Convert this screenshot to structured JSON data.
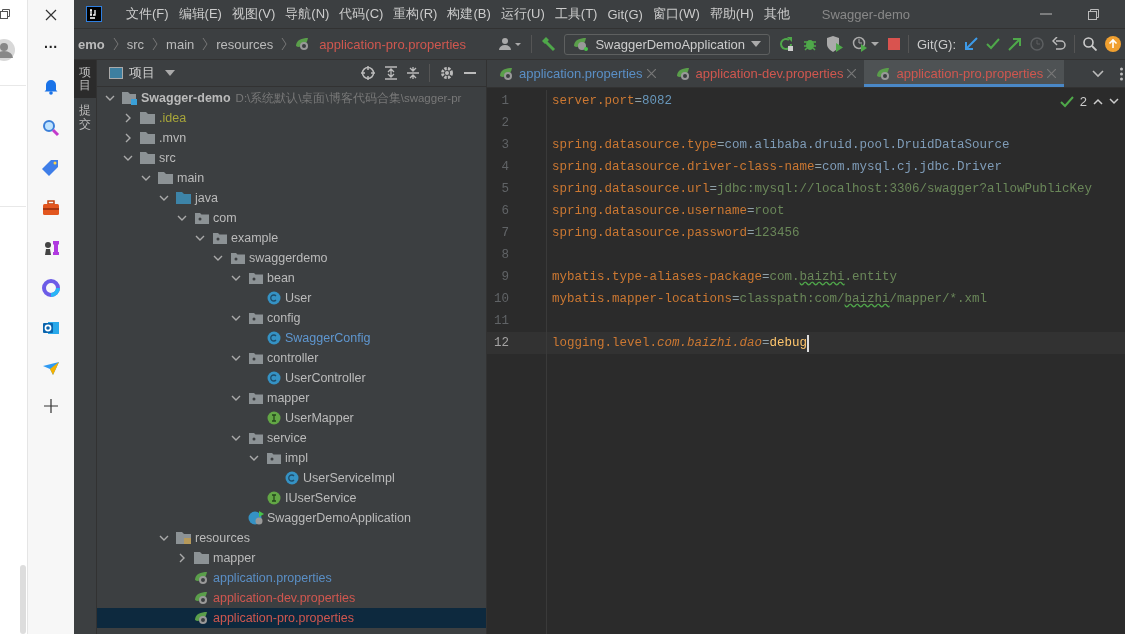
{
  "browser_sidebar": {
    "more": "···"
  },
  "menu": [
    "文件(F)",
    "编辑(E)",
    "视图(V)",
    "导航(N)",
    "代码(C)",
    "重构(R)",
    "构建(B)",
    "运行(U)",
    "工具(T)",
    "Git(G)",
    "窗口(W)",
    "帮助(H)",
    "其他"
  ],
  "window": {
    "title": "Swagger-demo"
  },
  "breadcrumbs": [
    {
      "label": "emo",
      "kind": "folder"
    },
    {
      "label": "src",
      "kind": "folder"
    },
    {
      "label": "main",
      "kind": "folder"
    },
    {
      "label": "resources",
      "kind": "folder"
    },
    {
      "label": "application-pro.properties",
      "kind": "file"
    }
  ],
  "run_config": {
    "label": "SwaggerDemoApplication"
  },
  "git_label": "Git(G):",
  "tool_strip": [
    {
      "label": "项目",
      "selected": true
    },
    {
      "label": "提交",
      "selected": false
    }
  ],
  "project_panel": {
    "title": "项目"
  },
  "tree": [
    {
      "label": "Swagger-demo",
      "path": "D:\\系统默认\\桌面\\博客代码合集\\swagger-pr",
      "kind": "module",
      "expanded": true,
      "selected": false,
      "color": "#bbbbbb",
      "children": [
        {
          "label": ".idea",
          "kind": "folder",
          "expanded": false,
          "selected": false,
          "color": "#a8a63a"
        },
        {
          "label": ".mvn",
          "kind": "folder",
          "expanded": false,
          "selected": false,
          "color": "#bbbbbb"
        },
        {
          "label": "src",
          "kind": "folder",
          "expanded": true,
          "selected": false,
          "color": "#bbbbbb",
          "children": [
            {
              "label": "main",
              "kind": "folder",
              "expanded": true,
              "selected": false,
              "color": "#bbbbbb",
              "children": [
                {
                  "label": "java",
                  "kind": "source",
                  "expanded": true,
                  "selected": false,
                  "color": "#bbbbbb",
                  "children": [
                    {
                      "label": "com",
                      "kind": "package",
                      "expanded": true,
                      "selected": false,
                      "color": "#bbbbbb",
                      "children": [
                        {
                          "label": "example",
                          "kind": "package",
                          "expanded": true,
                          "selected": false,
                          "color": "#bbbbbb",
                          "children": [
                            {
                              "label": "swaggerdemo",
                              "kind": "package",
                              "expanded": true,
                              "selected": false,
                              "color": "#bbbbbb",
                              "children": [
                                {
                                  "label": "bean",
                                  "kind": "package",
                                  "expanded": true,
                                  "selected": false,
                                  "color": "#bbbbbb",
                                  "children": [
                                    {
                                      "label": "User",
                                      "kind": "class",
                                      "selected": false,
                                      "color": "#bbbbbb"
                                    }
                                  ]
                                },
                                {
                                  "label": "config",
                                  "kind": "package",
                                  "expanded": true,
                                  "selected": false,
                                  "color": "#bbbbbb",
                                  "children": [
                                    {
                                      "label": "SwaggerConfig",
                                      "kind": "class",
                                      "selected": false,
                                      "color": "#5f97d0"
                                    }
                                  ]
                                },
                                {
                                  "label": "controller",
                                  "kind": "package",
                                  "expanded": true,
                                  "selected": false,
                                  "color": "#bbbbbb",
                                  "children": [
                                    {
                                      "label": "UserController",
                                      "kind": "class",
                                      "selected": false,
                                      "color": "#bbbbbb"
                                    }
                                  ]
                                },
                                {
                                  "label": "mapper",
                                  "kind": "package",
                                  "expanded": true,
                                  "selected": false,
                                  "color": "#bbbbbb",
                                  "children": [
                                    {
                                      "label": "UserMapper",
                                      "kind": "interface",
                                      "selected": false,
                                      "color": "#bbbbbb"
                                    }
                                  ]
                                },
                                {
                                  "label": "service",
                                  "kind": "package",
                                  "expanded": true,
                                  "selected": false,
                                  "color": "#bbbbbb",
                                  "children": [
                                    {
                                      "label": "impl",
                                      "kind": "package",
                                      "expanded": true,
                                      "selected": false,
                                      "color": "#bbbbbb",
                                      "children": [
                                        {
                                          "label": "UserServiceImpl",
                                          "kind": "class",
                                          "selected": false,
                                          "color": "#bbbbbb"
                                        }
                                      ]
                                    },
                                    {
                                      "label": "IUserService",
                                      "kind": "interface",
                                      "selected": false,
                                      "color": "#bbbbbb"
                                    }
                                  ]
                                },
                                {
                                  "label": "SwaggerDemoApplication",
                                  "kind": "app",
                                  "selected": false,
                                  "color": "#bbbbbb"
                                }
                              ]
                            }
                          ]
                        }
                      ]
                    }
                  ]
                },
                {
                  "label": "resources",
                  "kind": "resources",
                  "expanded": true,
                  "selected": false,
                  "color": "#bbbbbb",
                  "children": [
                    {
                      "label": "mapper",
                      "kind": "folder",
                      "expanded": false,
                      "selected": false,
                      "color": "#bbbbbb"
                    },
                    {
                      "label": "application.properties",
                      "kind": "spring",
                      "selected": false,
                      "color": "#5a8fc6"
                    },
                    {
                      "label": "application-dev.properties",
                      "kind": "spring",
                      "selected": false,
                      "color": "#d0574f"
                    },
                    {
                      "label": "application-pro.properties",
                      "kind": "spring",
                      "selected": true,
                      "color": "#d0574f"
                    }
                  ]
                }
              ]
            }
          ]
        }
      ]
    }
  ],
  "tabs": [
    {
      "label": "application.properties",
      "selected": false,
      "color": "#5a8fc6"
    },
    {
      "label": "application-dev.properties",
      "selected": false,
      "color": "#d0574f"
    },
    {
      "label": "application-pro.properties",
      "selected": true,
      "color": "#d0574f"
    }
  ],
  "inspection": {
    "count": "2"
  },
  "code": [
    {
      "number": "1",
      "current": false,
      "segments": [
        {
          "text": "server.port",
          "kind": "key"
        },
        {
          "text": "=",
          "kind": "eq"
        },
        {
          "text": "8082",
          "kind": "number"
        }
      ]
    },
    {
      "number": "2",
      "current": false
    },
    {
      "number": "3",
      "current": false,
      "segments": [
        {
          "text": "spring.datasource.type",
          "kind": "key"
        },
        {
          "text": "=",
          "kind": "eq"
        },
        {
          "text": "com.alibaba.druid.pool.DruidDataSource",
          "kind": "ref"
        }
      ]
    },
    {
      "number": "4",
      "current": false,
      "segments": [
        {
          "text": "spring.datasource.driver-class-name",
          "kind": "key"
        },
        {
          "text": "=",
          "kind": "eq"
        },
        {
          "text": "com.mysql.cj.jdbc.Driver",
          "kind": "ref"
        }
      ]
    },
    {
      "number": "5",
      "current": false,
      "segments": [
        {
          "text": "spring.datasource.url",
          "kind": "key"
        },
        {
          "text": "=",
          "kind": "eq"
        },
        {
          "text": "jdbc:mysql://localhost:3306/swagger?allowPublicKey",
          "kind": "value"
        }
      ]
    },
    {
      "number": "6",
      "current": false,
      "segments": [
        {
          "text": "spring.datasource.username",
          "kind": "key"
        },
        {
          "text": "=",
          "kind": "eq"
        },
        {
          "text": "root",
          "kind": "value"
        }
      ]
    },
    {
      "number": "7",
      "current": false,
      "segments": [
        {
          "text": "spring.datasource.password",
          "kind": "key"
        },
        {
          "text": "=",
          "kind": "eq"
        },
        {
          "text": "123456",
          "kind": "value"
        }
      ]
    },
    {
      "number": "8",
      "current": false
    },
    {
      "number": "9",
      "current": false,
      "segments": [
        {
          "text": "mybatis.type-aliases-package",
          "kind": "key"
        },
        {
          "text": "=",
          "kind": "eq"
        },
        {
          "text": "com.",
          "kind": "value"
        },
        {
          "text": "baizhi",
          "kind": "typo"
        },
        {
          "text": ".entity",
          "kind": "value"
        }
      ]
    },
    {
      "number": "10",
      "current": false,
      "segments": [
        {
          "text": "mybatis.mapper-locations",
          "kind": "key"
        },
        {
          "text": "=",
          "kind": "eq"
        },
        {
          "text": "classpath:com/",
          "kind": "value"
        },
        {
          "text": "baizhi",
          "kind": "typo"
        },
        {
          "text": "/mapper/*.xml",
          "kind": "value"
        }
      ]
    },
    {
      "number": "11",
      "current": false
    },
    {
      "number": "12",
      "current": true,
      "segments": [
        {
          "text": "logging.level.",
          "kind": "key"
        },
        {
          "text": "com.baizhi.dao",
          "kind": "key-italic"
        },
        {
          "text": "=",
          "kind": "eq"
        },
        {
          "text": "debug",
          "kind": "keyword"
        }
      ]
    }
  ]
}
